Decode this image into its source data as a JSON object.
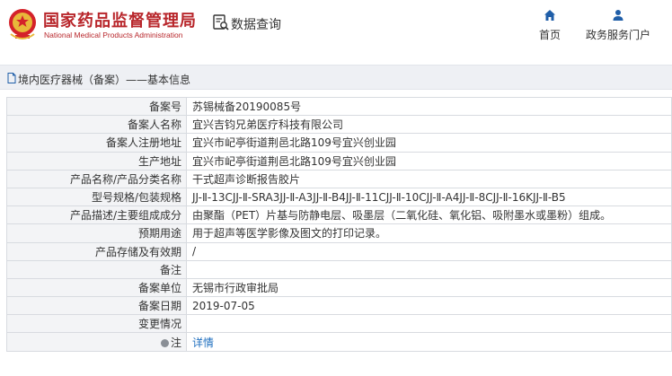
{
  "header": {
    "agency_cn": "国家药品监督管理局",
    "agency_en": "National Medical Products Administration",
    "query_label": "数据查询",
    "nav": [
      {
        "label": "首页",
        "icon": "home-icon"
      },
      {
        "label": "政务服务门户",
        "icon": "user-icon"
      }
    ]
  },
  "breadcrumb": {
    "text": "境内医疗器械（备案）——基本信息",
    "icon": "document-icon"
  },
  "colors": {
    "brand_red": "#b8262b",
    "nav_blue": "#1f5ea8",
    "link_blue": "#1f6fbf",
    "label_bg": "#f3f4f6"
  },
  "record": [
    {
      "label": "备案号",
      "value": "苏锡械备20190085号"
    },
    {
      "label": "备案人名称",
      "value": "宜兴吉钧兄弟医疗科技有限公司"
    },
    {
      "label": "备案人注册地址",
      "value": "宜兴市屺亭街道荆邑北路109号宜兴创业园"
    },
    {
      "label": "生产地址",
      "value": "宜兴市屺亭街道荆邑北路109号宜兴创业园"
    },
    {
      "label": "产品名称/产品分类名称",
      "value": "干式超声诊断报告胶片"
    },
    {
      "label": "型号规格/包装规格",
      "value": "JJ-Ⅱ-13CJJ-Ⅱ-SRA3JJ-Ⅱ-A3JJ-Ⅱ-B4JJ-Ⅱ-11CJJ-Ⅱ-10CJJ-Ⅱ-A4JJ-Ⅱ-8CJJ-Ⅱ-16KJJ-Ⅱ-B5"
    },
    {
      "label": "产品描述/主要组成成分",
      "value": "由聚酯（PET）片基与防静电层、吸墨层（二氧化硅、氧化铝、吸附墨水或墨粉）组成。"
    },
    {
      "label": "预期用途",
      "value": "用于超声等医学影像及图文的打印记录。"
    },
    {
      "label": "产品存储及有效期",
      "value": "/"
    },
    {
      "label": "备注",
      "value": ""
    },
    {
      "label": "备案单位",
      "value": "无锡市行政审批局"
    },
    {
      "label": "备案日期",
      "value": "2019-07-05"
    },
    {
      "label": "变更情况",
      "value": ""
    },
    {
      "label": "注",
      "value": "详情",
      "icon": "info-dot-icon"
    }
  ]
}
